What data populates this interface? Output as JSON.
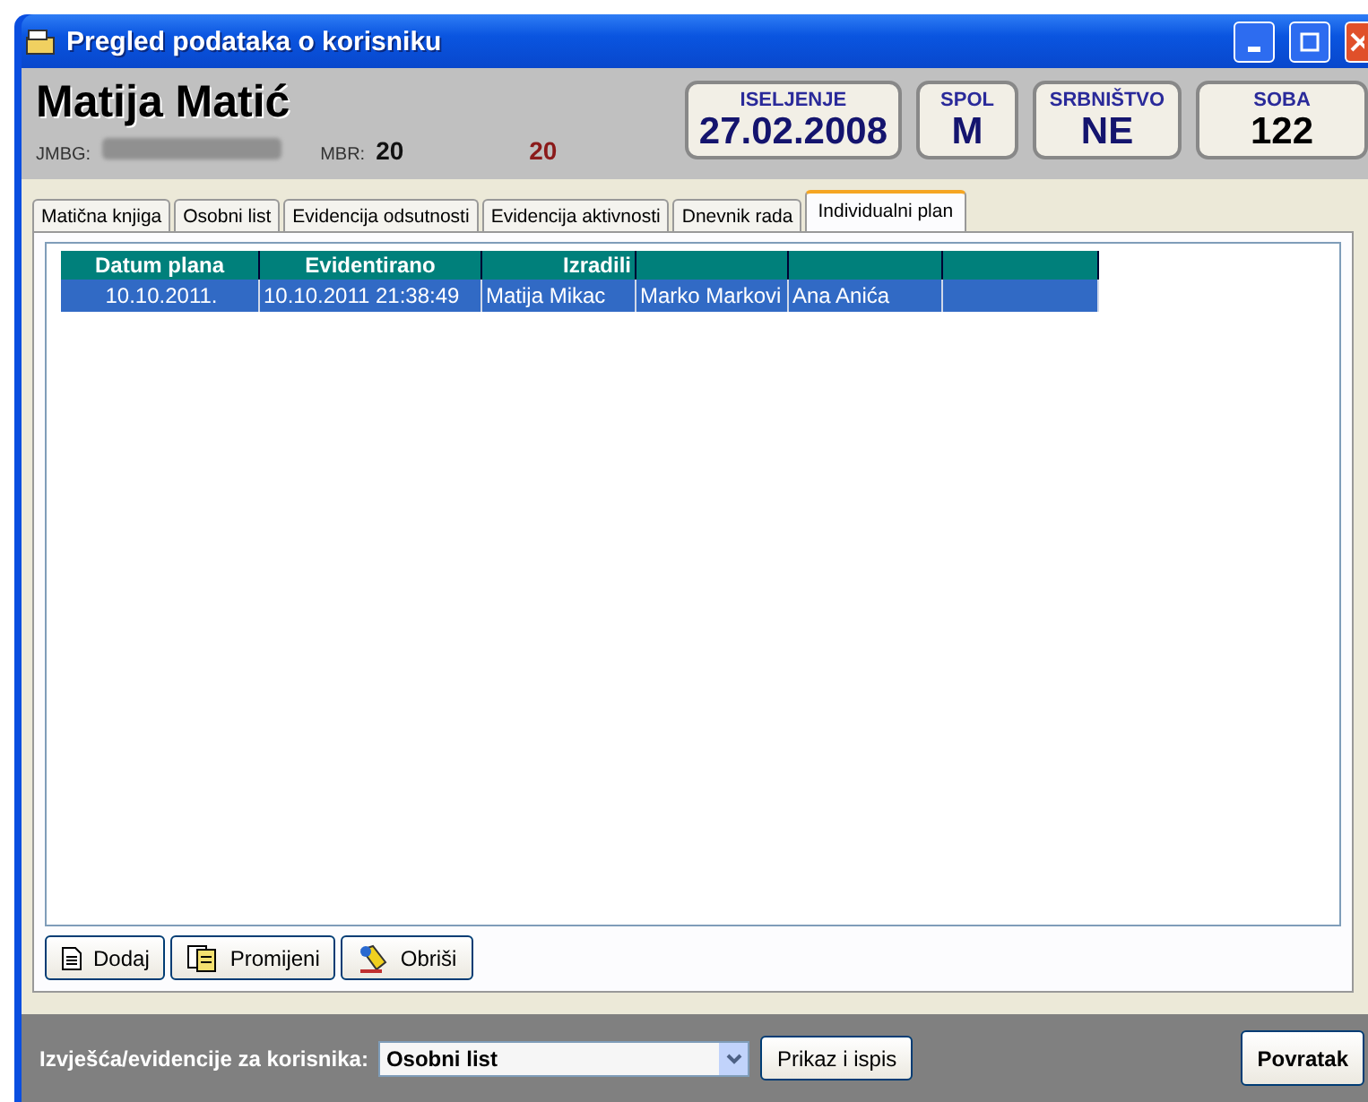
{
  "window": {
    "title": "Pregled podataka o korisniku"
  },
  "person": {
    "name": "Matija Matić",
    "jmbg_label": "JMBG:",
    "mbr_label": "MBR:",
    "mbr": "20",
    "number": "20"
  },
  "info_boxes": [
    {
      "label": "ISELJENJE",
      "value": "27.02.2008"
    },
    {
      "label": "SPOL",
      "value": "M"
    },
    {
      "label": "SRBNIŠTVO",
      "value": "NE"
    },
    {
      "label": "SOBA",
      "value": "122"
    }
  ],
  "tabs": [
    {
      "label": "Matična knjiga",
      "selected": false
    },
    {
      "label": "Osobni list",
      "selected": false
    },
    {
      "label": "Evidencija odsutnosti",
      "selected": false
    },
    {
      "label": "Evidencija aktivnosti",
      "selected": false
    },
    {
      "label": "Dnevnik rada",
      "selected": false
    },
    {
      "label": "Individualni plan",
      "selected": true
    }
  ],
  "table": {
    "columns": [
      "Datum plana",
      "Evidentirano",
      "Izradili",
      "",
      "",
      ""
    ],
    "rows": [
      {
        "selected": true,
        "cells": [
          "10.10.2011.",
          "10.10.2011 21:38:49",
          "Matija Mikac",
          "Marko Markovi",
          "Ana Anića",
          ""
        ]
      }
    ]
  },
  "actions": [
    "Dodaj",
    "Promijeni",
    "Obriši"
  ],
  "footer": {
    "label": "Izvješća/evidencije za korisnika:",
    "select_value": "Osobni list",
    "show_button": "Prikaz i ispis",
    "back_button": "Povratak"
  }
}
